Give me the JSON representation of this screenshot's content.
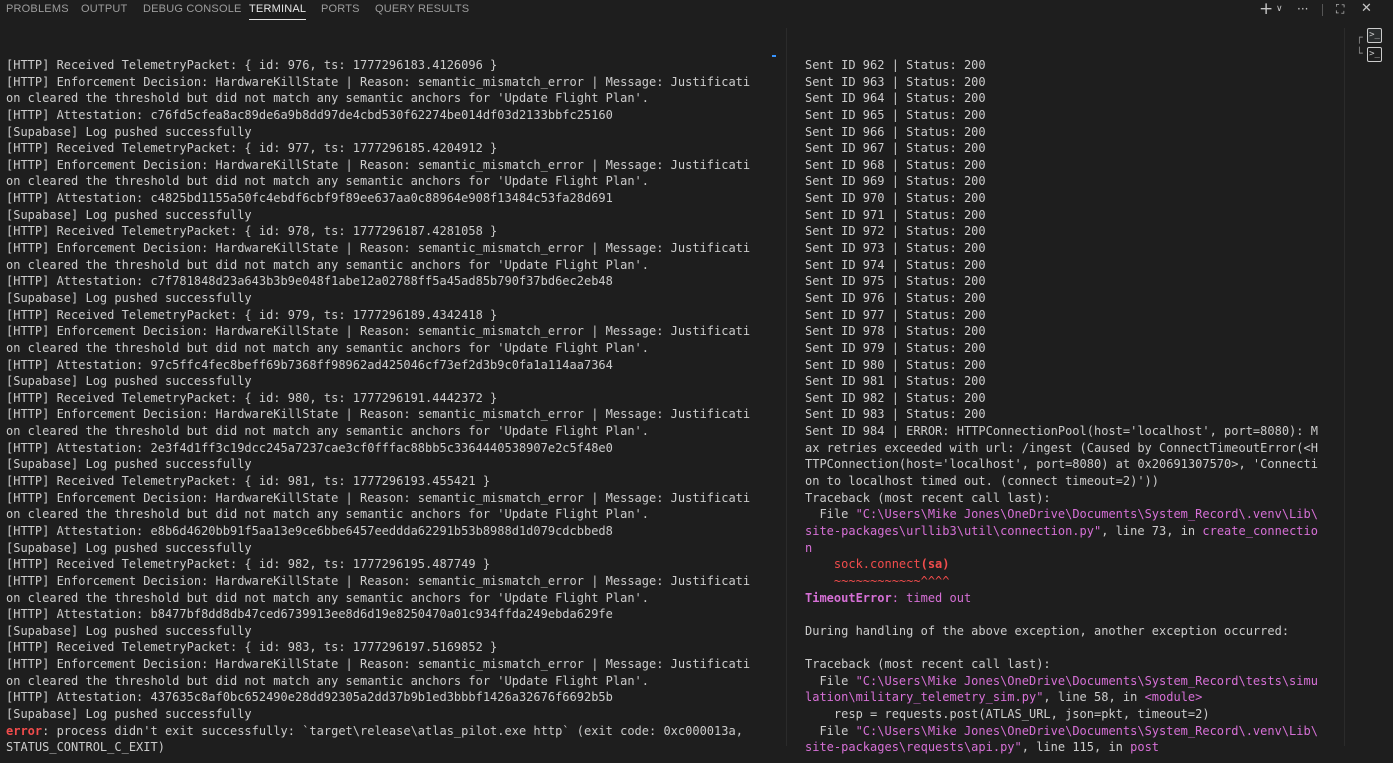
{
  "tabs": [
    {
      "label": "PROBLEMS",
      "active": false
    },
    {
      "label": "OUTPUT",
      "active": false
    },
    {
      "label": "DEBUG CONSOLE",
      "active": false
    },
    {
      "label": "TERMINAL",
      "active": true
    },
    {
      "label": "PORTS",
      "active": false
    },
    {
      "label": "QUERY RESULTS",
      "active": false
    }
  ],
  "toolbar": {
    "add": "+",
    "dropdown": "∨",
    "more": "···",
    "maximize": "⛶",
    "close": "✕"
  },
  "terminal_list": [
    {
      "icon": "terminal-icon",
      "glyph": ">_",
      "active": true
    },
    {
      "icon": "terminal-icon",
      "glyph": ">_",
      "active": false
    }
  ],
  "left_lines": [
    "[HTTP] Received TelemetryPacket: { id: 976, ts: 1777296183.4126096 }",
    "[HTTP] Enforcement Decision: HardwareKillState | Reason: semantic_mismatch_error | Message: Justificati",
    "on cleared the threshold but did not match any semantic anchors for 'Update Flight Plan'.",
    "[HTTP] Attestation: c76fd5cfea8ac89de6a9b8dd97de4cbd530f62274be014df03d2133bbfc25160",
    "[Supabase] Log pushed successfully",
    "[HTTP] Received TelemetryPacket: { id: 977, ts: 1777296185.4204912 }",
    "[HTTP] Enforcement Decision: HardwareKillState | Reason: semantic_mismatch_error | Message: Justificati",
    "on cleared the threshold but did not match any semantic anchors for 'Update Flight Plan'.",
    "[HTTP] Attestation: c4825bd1155a50fc4ebdf6cbf9f89ee637aa0c88964e908f13484c53fa28d691",
    "[Supabase] Log pushed successfully",
    "[HTTP] Received TelemetryPacket: { id: 978, ts: 1777296187.4281058 }",
    "[HTTP] Enforcement Decision: HardwareKillState | Reason: semantic_mismatch_error | Message: Justificati",
    "on cleared the threshold but did not match any semantic anchors for 'Update Flight Plan'.",
    "[HTTP] Attestation: c7f781848d23a643b3b9e048f1abe12a02788ff5a45ad85b790f37bd6ec2eb48",
    "[Supabase] Log pushed successfully",
    "[HTTP] Received TelemetryPacket: { id: 979, ts: 1777296189.4342418 }",
    "[HTTP] Enforcement Decision: HardwareKillState | Reason: semantic_mismatch_error | Message: Justificati",
    "on cleared the threshold but did not match any semantic anchors for 'Update Flight Plan'.",
    "[HTTP] Attestation: 97c5ffc4fec8beff69b7368ff98962ad425046cf73ef2d3b9c0fa1a114aa7364",
    "[Supabase] Log pushed successfully",
    "[HTTP] Received TelemetryPacket: { id: 980, ts: 1777296191.4442372 }",
    "[HTTP] Enforcement Decision: HardwareKillState | Reason: semantic_mismatch_error | Message: Justificati",
    "on cleared the threshold but did not match any semantic anchors for 'Update Flight Plan'.",
    "[HTTP] Attestation: 2e3f4d1ff3c19dcc245a7237cae3cf0fffac88bb5c3364440538907e2c5f48e0",
    "[Supabase] Log pushed successfully",
    "[HTTP] Received TelemetryPacket: { id: 981, ts: 1777296193.455421 }",
    "[HTTP] Enforcement Decision: HardwareKillState | Reason: semantic_mismatch_error | Message: Justificati",
    "on cleared the threshold but did not match any semantic anchors for 'Update Flight Plan'.",
    "[HTTP] Attestation: e8b6d4620bb91f5aa13e9ce6bbe6457eeddda62291b53b8988d1d079cdcbbed8",
    "[Supabase] Log pushed successfully",
    "[HTTP] Received TelemetryPacket: { id: 982, ts: 1777296195.487749 }",
    "[HTTP] Enforcement Decision: HardwareKillState | Reason: semantic_mismatch_error | Message: Justificati",
    "on cleared the threshold but did not match any semantic anchors for 'Update Flight Plan'.",
    "[HTTP] Attestation: b8477bf8dd8db47ced6739913ee8d6d19e8250470a01c934ffda249ebda629fe",
    "[Supabase] Log pushed successfully",
    "[HTTP] Received TelemetryPacket: { id: 983, ts: 1777296197.5169852 }",
    "[HTTP] Enforcement Decision: HardwareKillState | Reason: semantic_mismatch_error | Message: Justificati",
    "on cleared the threshold but did not match any semantic anchors for 'Update Flight Plan'.",
    "[HTTP] Attestation: 437635c8af0bc652490e28dd92305a2dd37b9b1ed3bbbf1426a32676f6692b5b",
    "[Supabase] Log pushed successfully"
  ],
  "left_error": {
    "prefix": "error",
    "text": ": process didn't exit successfully: `target\\release\\atlas_pilot.exe http` (exit code: 0xc000013a,",
    "cont": "STATUS_CONTROL_C_EXIT)"
  },
  "right_status_lines": [
    "Sent ID 962 | Status: 200",
    "Sent ID 963 | Status: 200",
    "Sent ID 964 | Status: 200",
    "Sent ID 965 | Status: 200",
    "Sent ID 966 | Status: 200",
    "Sent ID 967 | Status: 200",
    "Sent ID 968 | Status: 200",
    "Sent ID 969 | Status: 200",
    "Sent ID 970 | Status: 200",
    "Sent ID 971 | Status: 200",
    "Sent ID 972 | Status: 200",
    "Sent ID 973 | Status: 200",
    "Sent ID 974 | Status: 200",
    "Sent ID 975 | Status: 200",
    "Sent ID 976 | Status: 200",
    "Sent ID 977 | Status: 200",
    "Sent ID 978 | Status: 200",
    "Sent ID 979 | Status: 200",
    "Sent ID 980 | Status: 200",
    "Sent ID 981 | Status: 200",
    "Sent ID 982 | Status: 200",
    "Sent ID 983 | Status: 200"
  ],
  "right_error_lines": [
    "Sent ID 984 | ERROR: HTTPConnectionPool(host='localhost', port=8080): M",
    "ax retries exceeded with url: /ingest (Caused by ConnectTimeoutError(<H",
    "TTPConnection(host='localhost', port=8080) at 0x20691307570>, 'Connecti",
    "on to localhost timed out. (connect timeout=2)'))",
    "Traceback (most recent call last):"
  ],
  "tb1": {
    "file_prefix": "  File ",
    "path_l1": "\"C:\\Users\\Mike Jones\\OneDrive\\Documents\\System_Record\\.venv\\Lib\\",
    "path_l2": "site-packages\\urllib3\\util\\connection.py\"",
    "line_mid": ", line 73, in ",
    "func_l2": "create_connectio",
    "func_l3": "n",
    "code_plain": "    sock.connect",
    "code_hl": "(sa)",
    "tilde": "    ~~~~~~~~~~~~^^^^",
    "exc_name": "TimeoutError",
    "exc_msg": ": timed out"
  },
  "during": "During handling of the above exception, another exception occurred:",
  "tb2": {
    "header": "Traceback (most recent call last):",
    "file_prefix": "  File ",
    "path_l1": "\"C:\\Users\\Mike Jones\\OneDrive\\Documents\\System_Record\\tests\\simu",
    "path_l2": "lation\\military_telemetry_sim.py\"",
    "line_mid": ", line 58, in ",
    "func": "<module>",
    "code": "    resp = requests.post(ATLAS_URL, json=pkt, timeout=2)",
    "file2_path_l1": "\"C:\\Users\\Mike Jones\\OneDrive\\Documents\\System_Record\\.venv\\Lib\\",
    "file2_path_l2": "site-packages\\requests\\api.py\"",
    "file2_line_mid": ", line 115, in ",
    "file2_func": "post"
  },
  "colors": {
    "background": "#1e1e1e",
    "text": "#cccccc",
    "error": "#f14c4c",
    "path": "#d670d6",
    "accent": "#3794ff"
  }
}
